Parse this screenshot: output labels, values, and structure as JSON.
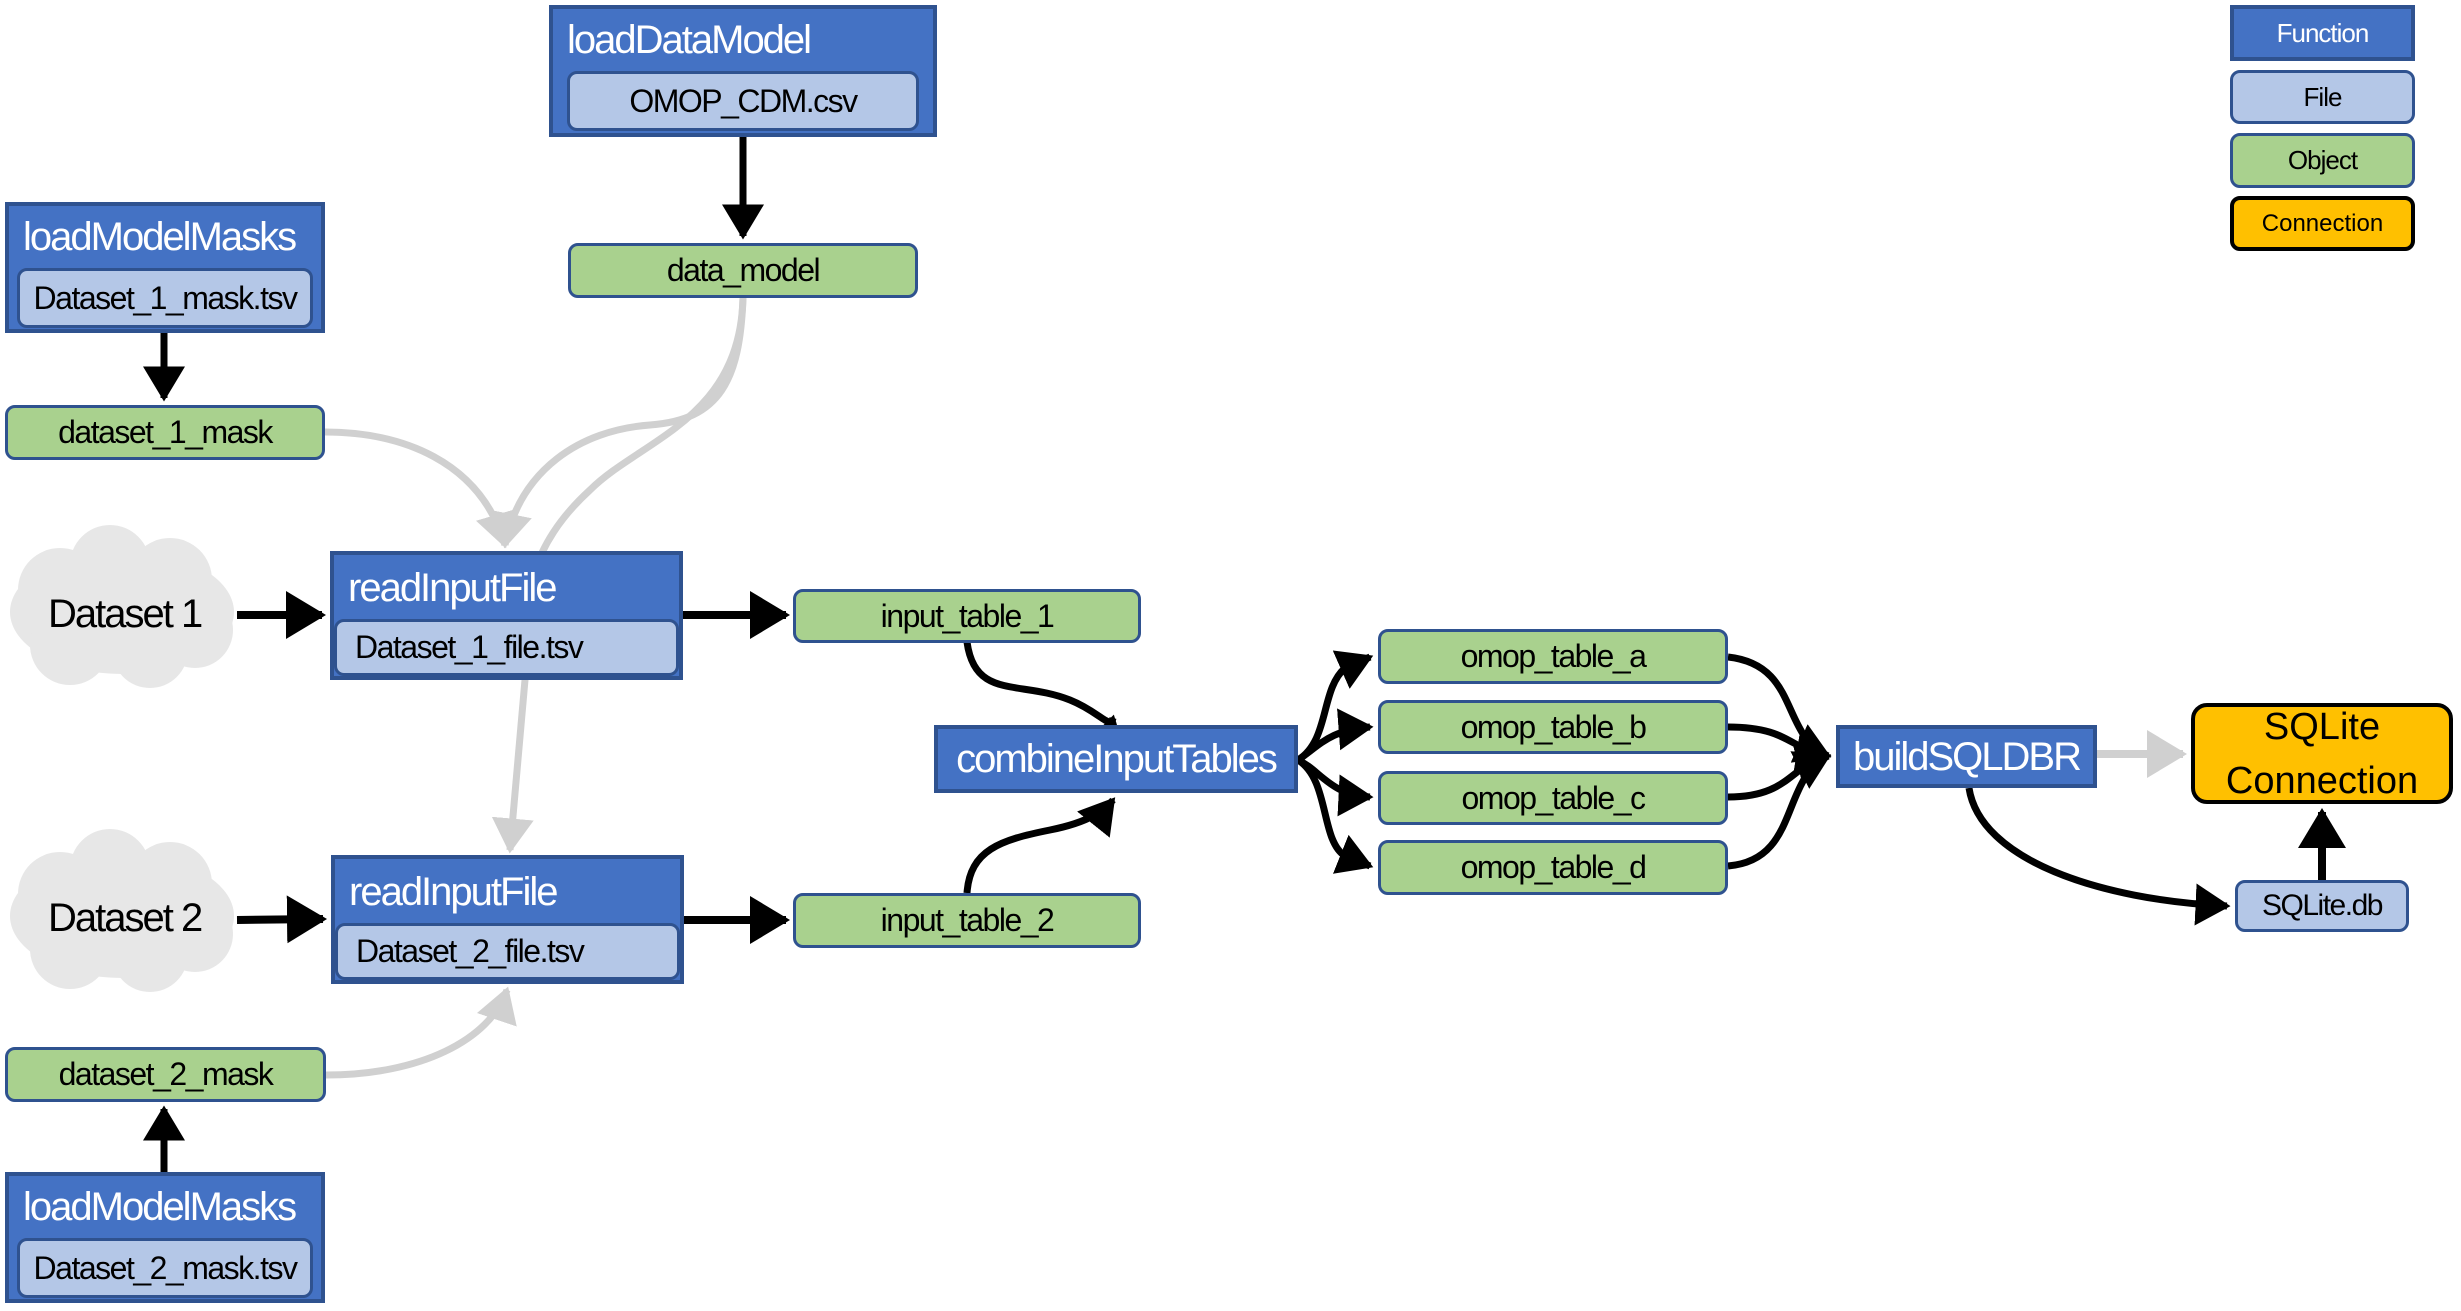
{
  "legend": {
    "function": "Function",
    "file": "File",
    "object": "Object",
    "connection": "Connection"
  },
  "colors": {
    "function": "#4472c4",
    "file": "#b4c7e7",
    "object": "#a9d18e",
    "connection": "#ffc000",
    "border": "#2f528f",
    "cloud": "#e7e7e7",
    "edge_primary": "#000000",
    "edge_secondary": "#d0d0d0"
  },
  "nodes": {
    "load_data_model": {
      "label": "loadDataModel",
      "file": "OMOP_CDM.csv"
    },
    "data_model": {
      "label": "data_model"
    },
    "load_model_masks_1": {
      "label": "loadModelMasks",
      "file": "Dataset_1_mask.tsv"
    },
    "dataset_1_mask": {
      "label": "dataset_1_mask"
    },
    "dataset_1": {
      "label": "Dataset 1"
    },
    "read_input_file_1": {
      "label": "readInputFile",
      "file": "Dataset_1_file.tsv"
    },
    "input_table_1": {
      "label": "input_table_1"
    },
    "dataset_2": {
      "label": "Dataset 2"
    },
    "read_input_file_2": {
      "label": "readInputFile",
      "file": "Dataset_2_file.tsv"
    },
    "input_table_2": {
      "label": "input_table_2"
    },
    "dataset_2_mask": {
      "label": "dataset_2_mask"
    },
    "load_model_masks_2": {
      "label": "loadModelMasks",
      "file": "Dataset_2_mask.tsv"
    },
    "combine_input_tables": {
      "label": "combineInputTables"
    },
    "omop_table_a": {
      "label": "omop_table_a"
    },
    "omop_table_b": {
      "label": "omop_table_b"
    },
    "omop_table_c": {
      "label": "omop_table_c"
    },
    "omop_table_d": {
      "label": "omop_table_d"
    },
    "build_sqldbr": {
      "label": "buildSQLDBR"
    },
    "sqlite_connection": {
      "line1": "SQLite",
      "line2": "Connection"
    },
    "sqlite_db": {
      "label": "SQLite.db"
    }
  },
  "edges": [
    {
      "from": "load_data_model",
      "to": "data_model",
      "kind": "primary"
    },
    {
      "from": "load_model_masks_1",
      "to": "dataset_1_mask",
      "kind": "primary"
    },
    {
      "from": "data_model",
      "to": "read_input_file_1",
      "kind": "secondary"
    },
    {
      "from": "dataset_1_mask",
      "to": "read_input_file_1",
      "kind": "secondary"
    },
    {
      "from": "data_model",
      "to": "read_input_file_2",
      "kind": "secondary"
    },
    {
      "from": "dataset_2_mask",
      "to": "read_input_file_2",
      "kind": "secondary"
    },
    {
      "from": "load_model_masks_2",
      "to": "dataset_2_mask",
      "kind": "primary"
    },
    {
      "from": "dataset_1",
      "to": "read_input_file_1",
      "kind": "primary"
    },
    {
      "from": "dataset_2",
      "to": "read_input_file_2",
      "kind": "primary"
    },
    {
      "from": "read_input_file_1",
      "to": "input_table_1",
      "kind": "primary"
    },
    {
      "from": "read_input_file_2",
      "to": "input_table_2",
      "kind": "primary"
    },
    {
      "from": "input_table_1",
      "to": "combine_input_tables",
      "kind": "primary"
    },
    {
      "from": "input_table_2",
      "to": "combine_input_tables",
      "kind": "primary"
    },
    {
      "from": "combine_input_tables",
      "to": "omop_table_a",
      "kind": "primary"
    },
    {
      "from": "combine_input_tables",
      "to": "omop_table_b",
      "kind": "primary"
    },
    {
      "from": "combine_input_tables",
      "to": "omop_table_c",
      "kind": "primary"
    },
    {
      "from": "combine_input_tables",
      "to": "omop_table_d",
      "kind": "primary"
    },
    {
      "from": "omop_table_a",
      "to": "build_sqldbr",
      "kind": "primary"
    },
    {
      "from": "omop_table_b",
      "to": "build_sqldbr",
      "kind": "primary"
    },
    {
      "from": "omop_table_c",
      "to": "build_sqldbr",
      "kind": "primary"
    },
    {
      "from": "omop_table_d",
      "to": "build_sqldbr",
      "kind": "primary"
    },
    {
      "from": "build_sqldbr",
      "to": "sqlite_connection",
      "kind": "secondary"
    },
    {
      "from": "build_sqldbr",
      "to": "sqlite_db",
      "kind": "primary"
    },
    {
      "from": "sqlite_db",
      "to": "sqlite_connection",
      "kind": "primary"
    }
  ]
}
